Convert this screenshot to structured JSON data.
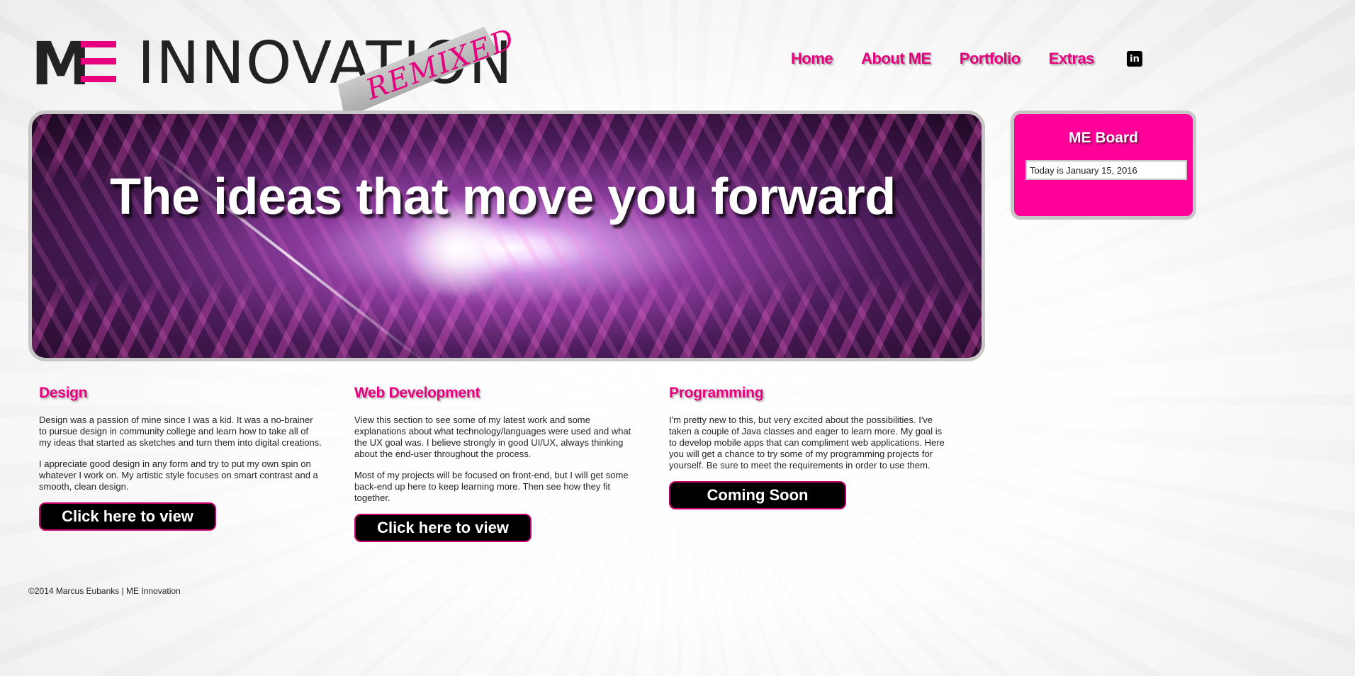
{
  "brand": {
    "logo_letters": "M",
    "logo_text": "INNOVATION",
    "logo_tag": "REMIXED",
    "accent_color": "#e6007e",
    "board_color": "#ff0099"
  },
  "nav": {
    "items": [
      {
        "label": "Home"
      },
      {
        "label": "About ME"
      },
      {
        "label": "Portfolio"
      },
      {
        "label": "Extras"
      }
    ],
    "social_icon": "linkedin-icon",
    "social_glyph": "in"
  },
  "hero": {
    "title": "The ideas that move you forward"
  },
  "board": {
    "title": "ME Board",
    "date_text": "Today is January 15, 2016"
  },
  "sections": [
    {
      "heading": "Design",
      "paragraphs": [
        "Design was a passion of mine since I was a kid. It was a no-brainer to pursue design in community college and learn how to take all of my ideas that started as sketches and turn them into digital creations.",
        "I appreciate good design in any form and try to put my own spin on whatever I work on. My artistic style focuses on smart contrast and a smooth, clean design."
      ],
      "button": "Click here to view"
    },
    {
      "heading": "Web Development",
      "paragraphs": [
        "View this section to see some of my latest work and some explanations about what technology/languages were used and what the UX goal was. I believe strongly in good UI/UX, always thinking about the end-user throughout the process.",
        "Most of my projects will be focused on front-end, but I will get some back-end up here to keep learning more. Then see how they fit together."
      ],
      "button": "Click here to view"
    },
    {
      "heading": "Programming",
      "paragraphs": [
        "I'm pretty new to this, but very excited about the possibilities. I've taken a couple of Java classes and eager to learn more. My goal is to develop mobile apps that can compliment web applications. Here you will get a chance to try some of my programming projects for yourself. Be sure to meet the requirements in order to use them."
      ],
      "button": "Coming Soon"
    }
  ],
  "footer": {
    "text": "©2014 Marcus Eubanks | ME Innovation"
  }
}
